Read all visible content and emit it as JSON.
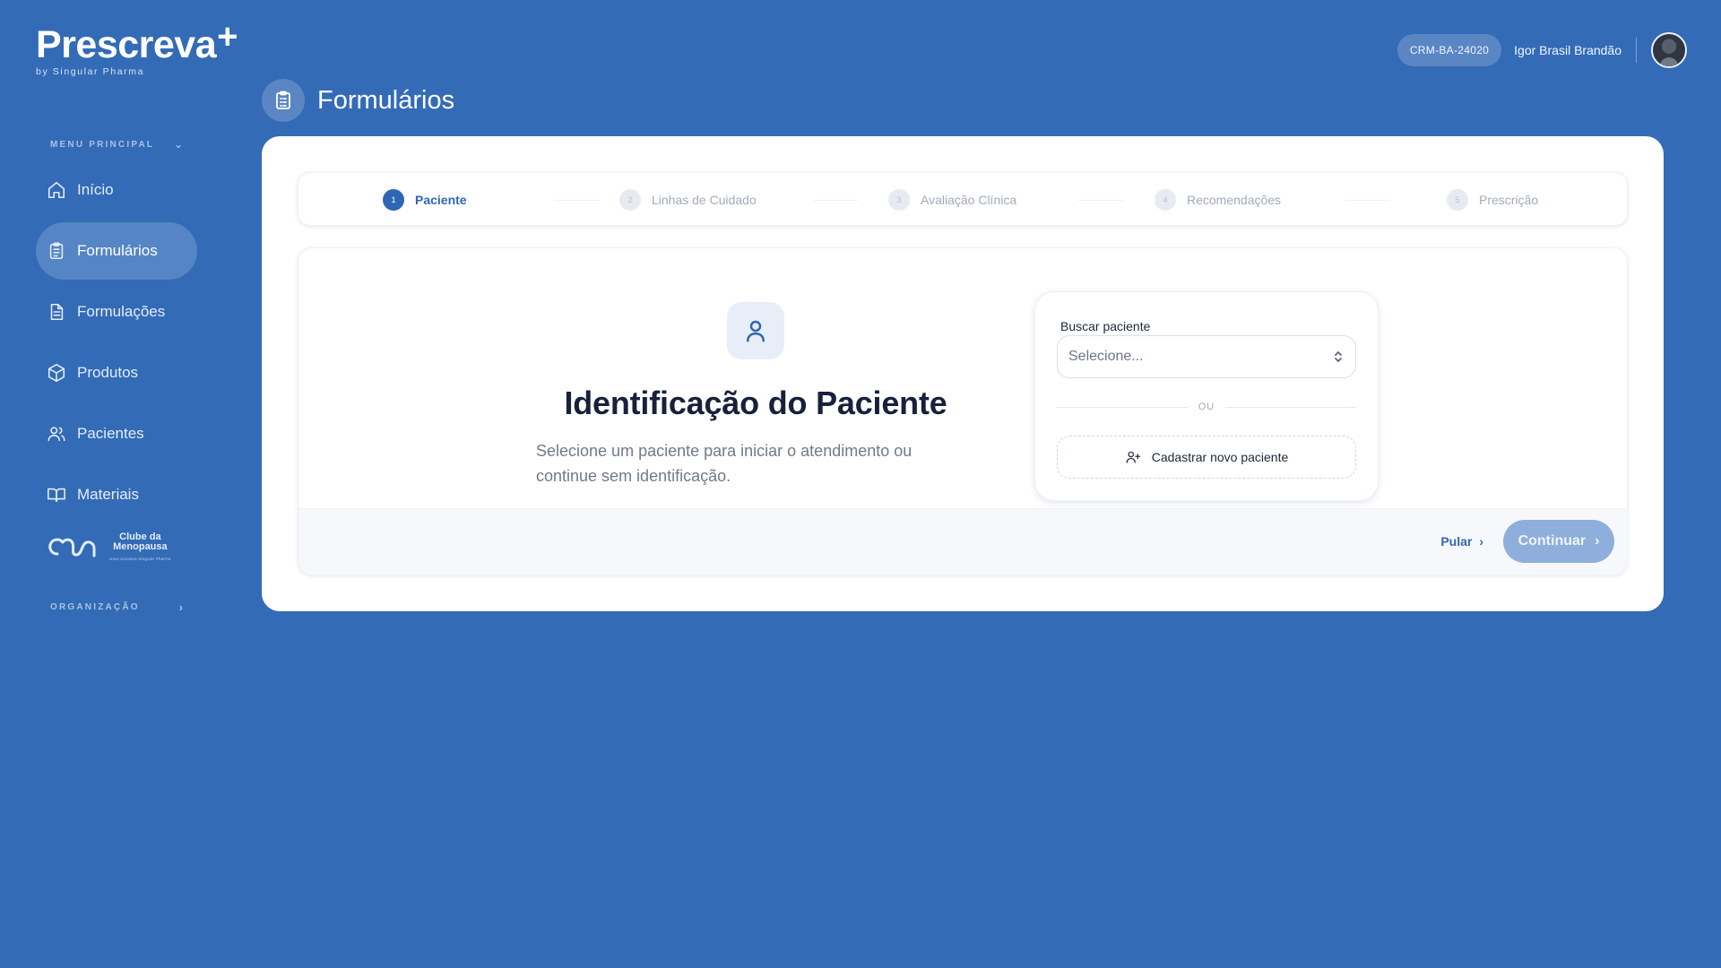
{
  "brand": {
    "name": "Prescreva",
    "plus": "+",
    "tagline": "by Singular Pharma"
  },
  "sidebar": {
    "menu_heading": "MENU PRINCIPAL",
    "items": [
      {
        "label": "Início",
        "icon": "home-icon",
        "active": false
      },
      {
        "label": "Formulários",
        "icon": "clipboard-icon",
        "active": true
      },
      {
        "label": "Formulações",
        "icon": "document-icon",
        "active": false
      },
      {
        "label": "Produtos",
        "icon": "package-icon",
        "active": false
      },
      {
        "label": "Pacientes",
        "icon": "users-icon",
        "active": false
      },
      {
        "label": "Materiais",
        "icon": "book-icon",
        "active": false
      }
    ],
    "club": {
      "line1": "Clube da",
      "line2": "Menopausa",
      "sub": "Uma iniciativa Singular Pharma"
    },
    "org_heading": "ORGANIZAÇÃO"
  },
  "user": {
    "crm": "CRM-BA-24020",
    "name": "Igor Brasil Brandão"
  },
  "page": {
    "title": "Formulários"
  },
  "stepper": {
    "steps": [
      {
        "num": "1",
        "label": "Paciente",
        "active": true
      },
      {
        "num": "2",
        "label": "Linhas de Cuidado",
        "active": false
      },
      {
        "num": "3",
        "label": "Avaliação Clínica",
        "active": false
      },
      {
        "num": "4",
        "label": "Recomendações",
        "active": false
      },
      {
        "num": "5",
        "label": "Prescrição",
        "active": false
      }
    ]
  },
  "identification": {
    "heading": "Identificação do Paciente",
    "description": "Selecione um paciente para iniciar o atendimento ou continue sem identificação."
  },
  "search": {
    "label": "Buscar paciente",
    "placeholder": "Selecione...",
    "or": "OU",
    "new_patient": "Cadastrar novo paciente"
  },
  "footer": {
    "skip": "Pular",
    "continue": "Continuar"
  },
  "colors": {
    "background": "#336bb6",
    "accent": "#2f66b3",
    "continue_disabled": "#8eaedb"
  }
}
